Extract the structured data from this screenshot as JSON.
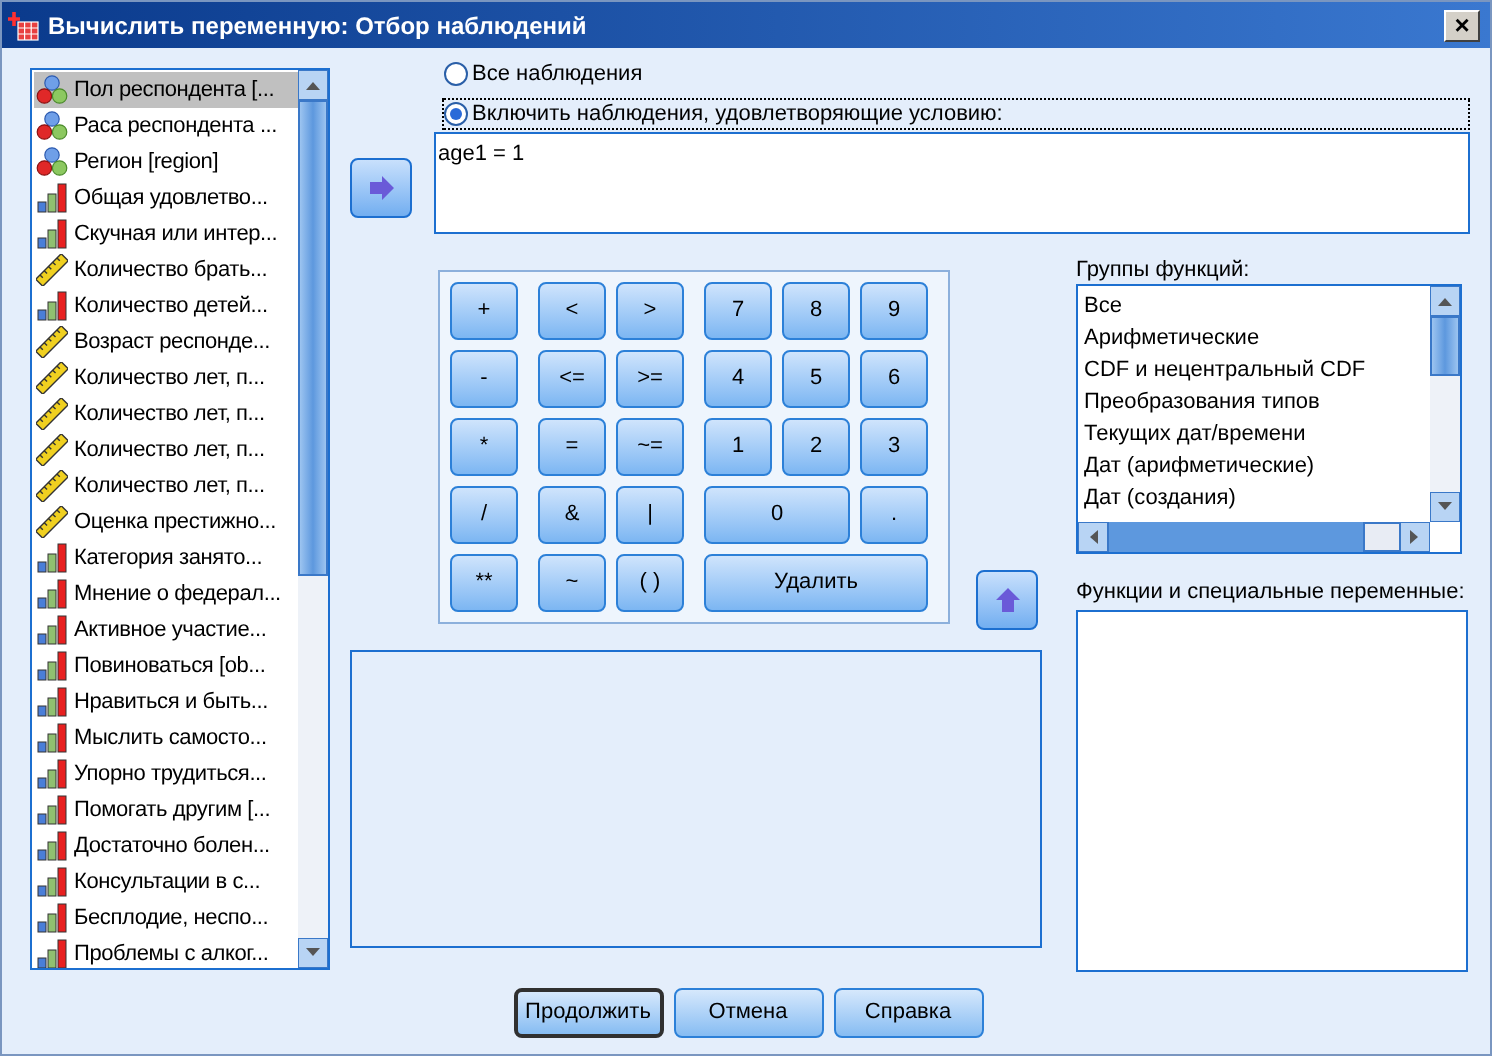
{
  "window": {
    "title": "Вычислить переменную: Отбор наблюдений",
    "close": "×"
  },
  "variables": [
    {
      "label": "Пол респондента [...",
      "kind": "nominal",
      "selected": true
    },
    {
      "label": "Раса респондента ...",
      "kind": "nominal",
      "selected": false
    },
    {
      "label": "Регион [region]",
      "kind": "nominal",
      "selected": false
    },
    {
      "label": "Общая удовлетво...",
      "kind": "ordinal",
      "selected": false
    },
    {
      "label": "Скучная или интер...",
      "kind": "ordinal",
      "selected": false
    },
    {
      "label": "Количество брать...",
      "kind": "scale",
      "selected": false
    },
    {
      "label": "Количество детей...",
      "kind": "ordinal",
      "selected": false
    },
    {
      "label": "Возраст респонде...",
      "kind": "scale",
      "selected": false
    },
    {
      "label": "Количество лет, п...",
      "kind": "scale",
      "selected": false
    },
    {
      "label": "Количество лет, п...",
      "kind": "scale",
      "selected": false
    },
    {
      "label": "Количество лет, п...",
      "kind": "scale",
      "selected": false
    },
    {
      "label": "Количество лет, п...",
      "kind": "scale",
      "selected": false
    },
    {
      "label": "Оценка престижно...",
      "kind": "scale",
      "selected": false
    },
    {
      "label": "Категория занято...",
      "kind": "ordinal",
      "selected": false
    },
    {
      "label": "Мнение о федерал...",
      "kind": "ordinal",
      "selected": false
    },
    {
      "label": "Активное участие...",
      "kind": "ordinal",
      "selected": false
    },
    {
      "label": "Повиноваться [ob...",
      "kind": "ordinal",
      "selected": false
    },
    {
      "label": "Нравиться и быть...",
      "kind": "ordinal",
      "selected": false
    },
    {
      "label": "Мыслить самосто...",
      "kind": "ordinal",
      "selected": false
    },
    {
      "label": "Упорно трудиться...",
      "kind": "ordinal",
      "selected": false
    },
    {
      "label": "Помогать другим [...",
      "kind": "ordinal",
      "selected": false
    },
    {
      "label": "Достаточно болен...",
      "kind": "ordinal",
      "selected": false
    },
    {
      "label": "Консультации в с...",
      "kind": "ordinal",
      "selected": false
    },
    {
      "label": "Бесплодие, неспо...",
      "kind": "ordinal",
      "selected": false
    },
    {
      "label": "Проблемы с алког...",
      "kind": "ordinal",
      "selected": false
    }
  ],
  "selection_options": [
    {
      "label": "Все наблюдения",
      "selected": false
    },
    {
      "label": "Включить наблюдения, удовлетворяющие условию:",
      "selected": true
    }
  ],
  "condition": {
    "value": "age1 = 1"
  },
  "keypad": {
    "operators": [
      "+",
      "-",
      "*",
      "/",
      "**"
    ],
    "comparisons": [
      "<",
      ">",
      "<=",
      ">=",
      "=",
      "~=",
      "&",
      "|",
      "~",
      "( )"
    ],
    "digits": [
      "7",
      "8",
      "9",
      "4",
      "5",
      "6",
      "1",
      "2",
      "3",
      "0",
      "."
    ],
    "delete": "Удалить"
  },
  "function_groups": {
    "label": "Группы функций:",
    "items": [
      "Все",
      "Арифметические",
      "CDF и нецентральный CDF",
      "Преобразования типов",
      "Текущих дат/времени",
      "Дат (арифметические)",
      "Дат (создания)"
    ]
  },
  "functions": {
    "label": "Функции и специальные переменные:"
  },
  "buttons": [
    {
      "label": "Продолжить",
      "default": true
    },
    {
      "label": "Отмена",
      "default": false
    },
    {
      "label": "Справка",
      "default": false
    }
  ]
}
